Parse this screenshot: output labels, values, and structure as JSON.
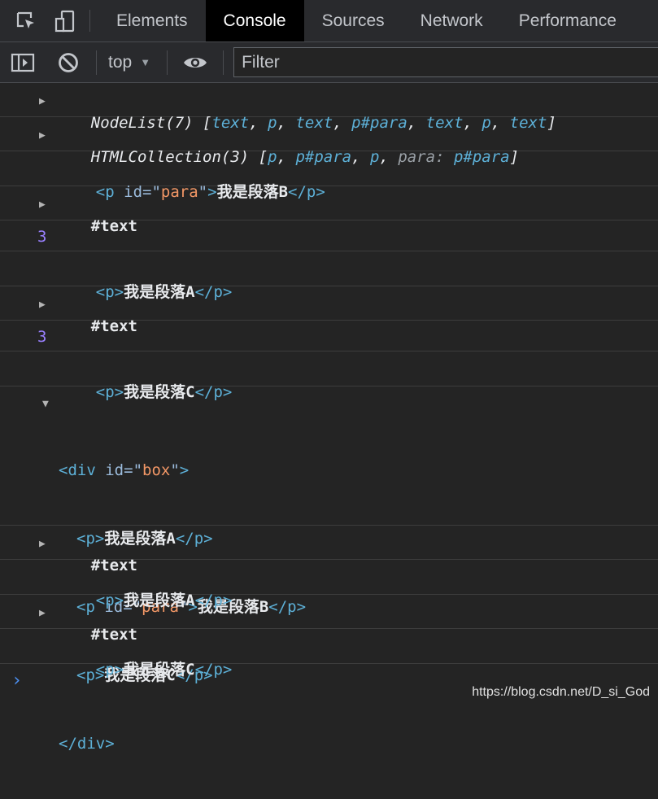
{
  "tabs": {
    "items": [
      {
        "label": "Elements"
      },
      {
        "label": "Console"
      },
      {
        "label": "Sources"
      },
      {
        "label": "Network"
      },
      {
        "label": "Performance"
      }
    ]
  },
  "toolbar": {
    "context": "top",
    "filter_placeholder": "Filter"
  },
  "console": {
    "row1": {
      "prefix": "NodeList(7) [",
      "items": [
        "text",
        "p",
        "text",
        "p#para",
        "text",
        "p",
        "text"
      ],
      "suffix": "]"
    },
    "row2": {
      "prefix": "HTMLCollection(3) [",
      "items": [
        "p",
        "p#para",
        "p"
      ],
      "key": "para",
      "val": "p#para",
      "suffix": "]"
    },
    "para_attr_name": "id",
    "para_attr_value": "para",
    "text_node": "#text",
    "number": "3",
    "text_a": "我是段落A",
    "text_b": "我是段落B",
    "text_c": "我是段落C",
    "div_tag": "div",
    "div_attr_name": "id",
    "div_attr_value": "box",
    "tag_p": "p"
  },
  "watermark": "https://blog.csdn.net/D_si_God",
  "colors": {
    "background": "#242424",
    "tag": "#5db0d7",
    "attr_value": "#f29766",
    "number": "#9980ff",
    "prompt": "#4c8ff0"
  }
}
